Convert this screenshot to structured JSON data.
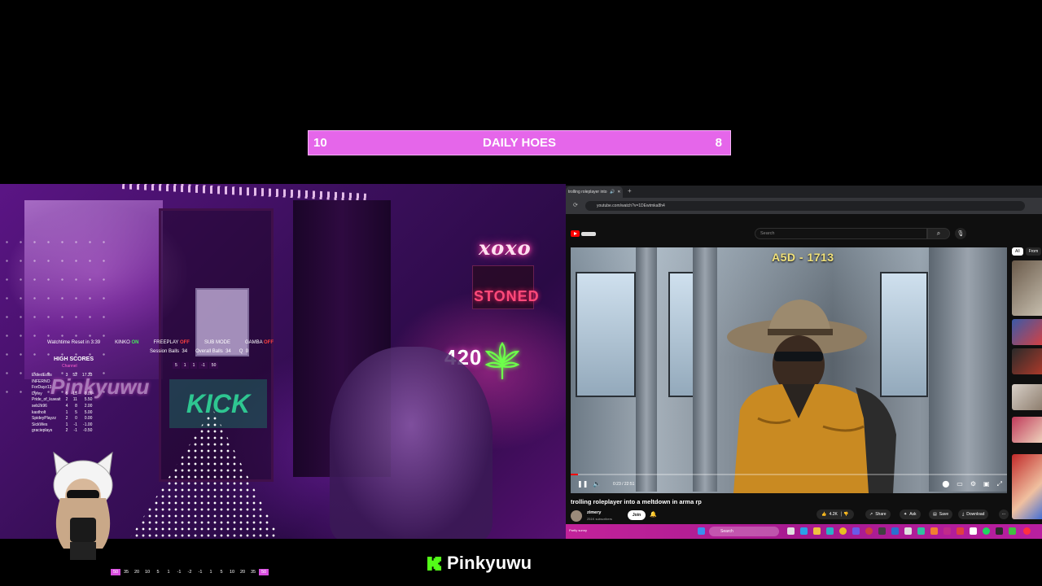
{
  "goal_bar": {
    "left_value": "10",
    "title": "DAILY HOES",
    "right_value": "8",
    "color": "#e566ea"
  },
  "webcam": {
    "neon_xoxo": "xoxo",
    "neon_stoned": "STONED",
    "neon_420": "420",
    "kick_sign": "KICK"
  },
  "stats": {
    "watchtime": "Watchtime Reset in 3:39",
    "toggles": [
      {
        "label": "KINKO",
        "state": "ON",
        "on": true
      },
      {
        "label": "FREEPLAY",
        "state": "OFF",
        "on": false
      },
      {
        "label": "SUB MODE",
        "state": "",
        "on": false
      },
      {
        "label": "GAMBA",
        "state": "OFF",
        "on": false
      }
    ],
    "session_balls_label": "Session Balls",
    "session_balls": "34",
    "overall_balls_label": "Overall Balls",
    "overall_balls": "34",
    "q_label": "Q",
    "q_value": "0",
    "high_scores_title": "HIGH SCORES",
    "high_scores_sub": "Channel",
    "odds": [
      "5",
      "1",
      "1",
      "-1",
      "50"
    ],
    "overlay_name": "Pinkyuwu",
    "scores": [
      {
        "name": "ExiledEdits",
        "a": "3",
        "b": "52",
        "c": "17.33"
      },
      {
        "name": "INFERNO",
        "a": "",
        "b": "",
        "c": ""
      },
      {
        "name": "ForDayz13",
        "a": "",
        "b": "",
        "c": ""
      },
      {
        "name": "Dyfey",
        "a": "5",
        "b": "15",
        "c": "3.00"
      },
      {
        "name": "Pride_of_kuwait",
        "a": "2",
        "b": "11",
        "c": "5.50"
      },
      {
        "name": "seb2k96",
        "a": "4",
        "b": "8",
        "c": "2.00"
      },
      {
        "name": "kastholt",
        "a": "1",
        "b": "5",
        "c": "5.00"
      },
      {
        "name": "SpideyPlayzz",
        "a": "2",
        "b": "0",
        "c": "0.00"
      },
      {
        "name": "SickWes",
        "a": "1",
        "b": "-1",
        "c": "-1.00"
      },
      {
        "name": "gracieplays",
        "a": "2",
        "b": "-1",
        "c": "-0.50"
      }
    ]
  },
  "multipliers": [
    "50",
    "35",
    "20",
    "10",
    "5",
    "1",
    "-1",
    "-2",
    "-1",
    "1",
    "5",
    "10",
    "20",
    "35",
    "50"
  ],
  "channel": {
    "name": "Pinkyuwu",
    "logo": "kick-logo",
    "logo_color": "#53fc18"
  },
  "browser": {
    "tab_title": "trolling roleplayer into a meltdown in arma rp",
    "url": "youtube.com/watch?v=1DEwtmka8h4",
    "search_placeholder": "Search",
    "video": {
      "plate": "A5D - 1713",
      "time": "0:23 / 22:51",
      "progress": 0.017
    },
    "title": "trolling roleplayer into a meltdown in arma rp",
    "channel_name": "zimery",
    "subscribers": "251K subscribers",
    "join_label": "Join",
    "likes": "4.2K",
    "share_label": "Share",
    "ask_label": "Ask",
    "save_label": "Save",
    "download_label": "Download",
    "chips": [
      "All",
      "From"
    ],
    "taskbar_search": "Search",
    "taskbar_status": "Partly sunny"
  }
}
